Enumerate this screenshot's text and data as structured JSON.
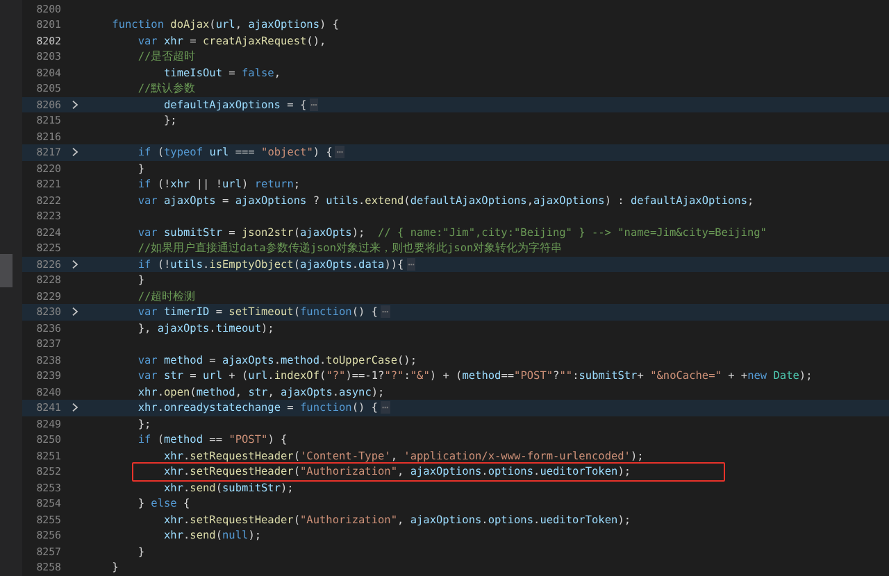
{
  "editor": {
    "lines": [
      {
        "number": "8200",
        "current": false,
        "folded": false,
        "highlighted": false
      },
      {
        "number": "8201",
        "current": false,
        "folded": false,
        "highlighted": false,
        "segs": [
          {
            "kind": "kw",
            "text": "    function "
          },
          {
            "kind": "fn",
            "text": "doAjax"
          },
          {
            "kind": "plain",
            "text": "("
          },
          {
            "kind": "var",
            "text": "url"
          },
          {
            "kind": "plain",
            "text": ", "
          },
          {
            "kind": "var",
            "text": "ajaxOptions"
          },
          {
            "kind": "plain",
            "text": ") {"
          }
        ]
      },
      {
        "number": "8202",
        "current": true,
        "folded": false,
        "highlighted": false,
        "segs": [
          {
            "kind": "kw",
            "text": "        var "
          },
          {
            "kind": "var",
            "text": "xhr"
          },
          {
            "kind": "plain",
            "text": " = "
          },
          {
            "kind": "fn",
            "text": "creatAjaxRequest"
          },
          {
            "kind": "plain",
            "text": "(),"
          }
        ]
      },
      {
        "number": "8203",
        "current": false,
        "folded": false,
        "highlighted": false,
        "segs": [
          {
            "kind": "cm",
            "text": "        //是否超时"
          }
        ]
      },
      {
        "number": "8204",
        "current": false,
        "folded": false,
        "highlighted": false,
        "segs": [
          {
            "kind": "var",
            "text": "            timeIsOut"
          },
          {
            "kind": "plain",
            "text": " = "
          },
          {
            "kind": "kw",
            "text": "false"
          },
          {
            "kind": "plain",
            "text": ","
          }
        ]
      },
      {
        "number": "8205",
        "current": false,
        "folded": false,
        "highlighted": false,
        "segs": [
          {
            "kind": "cm",
            "text": "        //默认参数"
          }
        ]
      },
      {
        "number": "8206",
        "current": false,
        "folded": true,
        "highlighted": false,
        "segs": [
          {
            "kind": "var",
            "text": "            defaultAjaxOptions"
          },
          {
            "kind": "plain",
            "text": " = {"
          },
          {
            "kind": "fold",
            "text": "⋯"
          }
        ]
      },
      {
        "number": "8215",
        "current": false,
        "folded": false,
        "highlighted": false,
        "segs": [
          {
            "kind": "plain",
            "text": "            };"
          }
        ]
      },
      {
        "number": "8216",
        "current": false,
        "folded": false,
        "highlighted": false
      },
      {
        "number": "8217",
        "current": false,
        "folded": true,
        "highlighted": false,
        "segs": [
          {
            "kind": "kw",
            "text": "        if"
          },
          {
            "kind": "plain",
            "text": " ("
          },
          {
            "kind": "kw",
            "text": "typeof "
          },
          {
            "kind": "var",
            "text": "url"
          },
          {
            "kind": "plain",
            "text": " === "
          },
          {
            "kind": "str",
            "text": "\"object\""
          },
          {
            "kind": "plain",
            "text": ") {"
          },
          {
            "kind": "fold",
            "text": "⋯"
          }
        ]
      },
      {
        "number": "8220",
        "current": false,
        "folded": false,
        "highlighted": false,
        "segs": [
          {
            "kind": "plain",
            "text": "        }"
          }
        ]
      },
      {
        "number": "8221",
        "current": false,
        "folded": false,
        "highlighted": false,
        "segs": [
          {
            "kind": "kw",
            "text": "        if"
          },
          {
            "kind": "plain",
            "text": " (!"
          },
          {
            "kind": "var",
            "text": "xhr"
          },
          {
            "kind": "plain",
            "text": " || !"
          },
          {
            "kind": "var",
            "text": "url"
          },
          {
            "kind": "plain",
            "text": ") "
          },
          {
            "kind": "kw",
            "text": "return"
          },
          {
            "kind": "plain",
            "text": ";"
          }
        ]
      },
      {
        "number": "8222",
        "current": false,
        "folded": false,
        "highlighted": false,
        "segs": [
          {
            "kind": "kw",
            "text": "        var "
          },
          {
            "kind": "var",
            "text": "ajaxOpts"
          },
          {
            "kind": "plain",
            "text": " = "
          },
          {
            "kind": "var",
            "text": "ajaxOptions"
          },
          {
            "kind": "plain",
            "text": " ? "
          },
          {
            "kind": "var",
            "text": "utils"
          },
          {
            "kind": "plain",
            "text": "."
          },
          {
            "kind": "fn",
            "text": "extend"
          },
          {
            "kind": "plain",
            "text": "("
          },
          {
            "kind": "var",
            "text": "defaultAjaxOptions"
          },
          {
            "kind": "plain",
            "text": ","
          },
          {
            "kind": "var",
            "text": "ajaxOptions"
          },
          {
            "kind": "plain",
            "text": ") : "
          },
          {
            "kind": "var",
            "text": "defaultAjaxOptions"
          },
          {
            "kind": "plain",
            "text": ";"
          }
        ]
      },
      {
        "number": "8223",
        "current": false,
        "folded": false,
        "highlighted": false
      },
      {
        "number": "8224",
        "current": false,
        "folded": false,
        "highlighted": false,
        "segs": [
          {
            "kind": "kw",
            "text": "        var "
          },
          {
            "kind": "var",
            "text": "submitStr"
          },
          {
            "kind": "plain",
            "text": " = "
          },
          {
            "kind": "fn",
            "text": "json2str"
          },
          {
            "kind": "plain",
            "text": "("
          },
          {
            "kind": "var",
            "text": "ajaxOpts"
          },
          {
            "kind": "plain",
            "text": ");  "
          },
          {
            "kind": "cm",
            "text": "// { name:\"Jim\",city:\"Beijing\" } --> \"name=Jim&city=Beijing\""
          }
        ]
      },
      {
        "number": "8225",
        "current": false,
        "folded": false,
        "highlighted": false,
        "segs": [
          {
            "kind": "cm",
            "text": "        //如果用户直接通过data参数传递json对象过来，则也要将此json对象转化为字符串"
          }
        ]
      },
      {
        "number": "8226",
        "current": false,
        "folded": true,
        "highlighted": false,
        "segs": [
          {
            "kind": "kw",
            "text": "        if"
          },
          {
            "kind": "plain",
            "text": " (!"
          },
          {
            "kind": "var",
            "text": "utils"
          },
          {
            "kind": "plain",
            "text": "."
          },
          {
            "kind": "fn",
            "text": "isEmptyObject"
          },
          {
            "kind": "plain",
            "text": "("
          },
          {
            "kind": "var",
            "text": "ajaxOpts"
          },
          {
            "kind": "plain",
            "text": "."
          },
          {
            "kind": "var",
            "text": "data"
          },
          {
            "kind": "plain",
            "text": ")){"
          },
          {
            "kind": "fold",
            "text": "⋯"
          }
        ]
      },
      {
        "number": "8228",
        "current": false,
        "folded": false,
        "highlighted": false,
        "segs": [
          {
            "kind": "plain",
            "text": "        }"
          }
        ]
      },
      {
        "number": "8229",
        "current": false,
        "folded": false,
        "highlighted": false,
        "segs": [
          {
            "kind": "cm",
            "text": "        //超时检测"
          }
        ]
      },
      {
        "number": "8230",
        "current": false,
        "folded": true,
        "highlighted": false,
        "segs": [
          {
            "kind": "kw",
            "text": "        var "
          },
          {
            "kind": "var",
            "text": "timerID"
          },
          {
            "kind": "plain",
            "text": " = "
          },
          {
            "kind": "fn",
            "text": "setTimeout"
          },
          {
            "kind": "plain",
            "text": "("
          },
          {
            "kind": "kw",
            "text": "function"
          },
          {
            "kind": "plain",
            "text": "() {"
          },
          {
            "kind": "fold",
            "text": "⋯"
          }
        ]
      },
      {
        "number": "8236",
        "current": false,
        "folded": false,
        "highlighted": false,
        "segs": [
          {
            "kind": "plain",
            "text": "        }, "
          },
          {
            "kind": "var",
            "text": "ajaxOpts"
          },
          {
            "kind": "plain",
            "text": "."
          },
          {
            "kind": "var",
            "text": "timeout"
          },
          {
            "kind": "plain",
            "text": ");"
          }
        ]
      },
      {
        "number": "8237",
        "current": false,
        "folded": false,
        "highlighted": false
      },
      {
        "number": "8238",
        "current": false,
        "folded": false,
        "highlighted": false,
        "segs": [
          {
            "kind": "kw",
            "text": "        var "
          },
          {
            "kind": "var",
            "text": "method"
          },
          {
            "kind": "plain",
            "text": " = "
          },
          {
            "kind": "var",
            "text": "ajaxOpts"
          },
          {
            "kind": "plain",
            "text": "."
          },
          {
            "kind": "var",
            "text": "method"
          },
          {
            "kind": "plain",
            "text": "."
          },
          {
            "kind": "fn",
            "text": "toUpperCase"
          },
          {
            "kind": "plain",
            "text": "();"
          }
        ]
      },
      {
        "number": "8239",
        "current": false,
        "folded": false,
        "highlighted": false,
        "segs": [
          {
            "kind": "kw",
            "text": "        var "
          },
          {
            "kind": "var",
            "text": "str"
          },
          {
            "kind": "plain",
            "text": " = "
          },
          {
            "kind": "var",
            "text": "url"
          },
          {
            "kind": "plain",
            "text": " + ("
          },
          {
            "kind": "var",
            "text": "url"
          },
          {
            "kind": "plain",
            "text": "."
          },
          {
            "kind": "fn",
            "text": "indexOf"
          },
          {
            "kind": "plain",
            "text": "("
          },
          {
            "kind": "str",
            "text": "\"?\""
          },
          {
            "kind": "plain",
            "text": ")==-1?"
          },
          {
            "kind": "str",
            "text": "\"?\""
          },
          {
            "kind": "plain",
            "text": ":"
          },
          {
            "kind": "str",
            "text": "\"&\""
          },
          {
            "kind": "plain",
            "text": ") + ("
          },
          {
            "kind": "var",
            "text": "method"
          },
          {
            "kind": "plain",
            "text": "=="
          },
          {
            "kind": "str",
            "text": "\"POST\""
          },
          {
            "kind": "plain",
            "text": "?"
          },
          {
            "kind": "str",
            "text": "\"\""
          },
          {
            "kind": "plain",
            "text": ":"
          },
          {
            "kind": "var",
            "text": "submitStr"
          },
          {
            "kind": "plain",
            "text": "+ "
          },
          {
            "kind": "str",
            "text": "\"&noCache=\""
          },
          {
            "kind": "plain",
            "text": " + +"
          },
          {
            "kind": "kw",
            "text": "new "
          },
          {
            "kind": "cls",
            "text": "Date"
          },
          {
            "kind": "plain",
            "text": ");"
          }
        ]
      },
      {
        "number": "8240",
        "current": false,
        "folded": false,
        "highlighted": false,
        "segs": [
          {
            "kind": "var",
            "text": "        xhr"
          },
          {
            "kind": "plain",
            "text": "."
          },
          {
            "kind": "fn",
            "text": "open"
          },
          {
            "kind": "plain",
            "text": "("
          },
          {
            "kind": "var",
            "text": "method"
          },
          {
            "kind": "plain",
            "text": ", "
          },
          {
            "kind": "var",
            "text": "str"
          },
          {
            "kind": "plain",
            "text": ", "
          },
          {
            "kind": "var",
            "text": "ajaxOpts"
          },
          {
            "kind": "plain",
            "text": "."
          },
          {
            "kind": "var",
            "text": "async"
          },
          {
            "kind": "plain",
            "text": ");"
          }
        ]
      },
      {
        "number": "8241",
        "current": false,
        "folded": true,
        "highlighted": false,
        "segs": [
          {
            "kind": "var",
            "text": "        xhr"
          },
          {
            "kind": "plain",
            "text": "."
          },
          {
            "kind": "var",
            "text": "onreadystatechange"
          },
          {
            "kind": "plain",
            "text": " = "
          },
          {
            "kind": "kw",
            "text": "function"
          },
          {
            "kind": "plain",
            "text": "() {"
          },
          {
            "kind": "fold",
            "text": "⋯"
          }
        ]
      },
      {
        "number": "8249",
        "current": false,
        "folded": false,
        "highlighted": false,
        "segs": [
          {
            "kind": "plain",
            "text": "        };"
          }
        ]
      },
      {
        "number": "8250",
        "current": false,
        "folded": false,
        "highlighted": false,
        "segs": [
          {
            "kind": "kw",
            "text": "        if"
          },
          {
            "kind": "plain",
            "text": " ("
          },
          {
            "kind": "var",
            "text": "method"
          },
          {
            "kind": "plain",
            "text": " == "
          },
          {
            "kind": "str",
            "text": "\"POST\""
          },
          {
            "kind": "plain",
            "text": ") {"
          }
        ]
      },
      {
        "number": "8251",
        "current": false,
        "folded": false,
        "highlighted": false,
        "segs": [
          {
            "kind": "var",
            "text": "            xhr"
          },
          {
            "kind": "plain",
            "text": "."
          },
          {
            "kind": "fn",
            "text": "setRequestHeader"
          },
          {
            "kind": "plain",
            "text": "("
          },
          {
            "kind": "str",
            "text": "'Content-Type'"
          },
          {
            "kind": "plain",
            "text": ", "
          },
          {
            "kind": "str",
            "text": "'application/x-www-form-urlencoded'"
          },
          {
            "kind": "plain",
            "text": ");"
          }
        ]
      },
      {
        "number": "8252",
        "current": false,
        "folded": false,
        "highlighted": true,
        "segs": [
          {
            "kind": "var",
            "text": "            xhr"
          },
          {
            "kind": "plain",
            "text": "."
          },
          {
            "kind": "fn",
            "text": "setRequestHeader"
          },
          {
            "kind": "plain",
            "text": "("
          },
          {
            "kind": "str",
            "text": "\"Authorization\""
          },
          {
            "kind": "plain",
            "text": ", "
          },
          {
            "kind": "var",
            "text": "ajaxOptions"
          },
          {
            "kind": "plain",
            "text": "."
          },
          {
            "kind": "var",
            "text": "options"
          },
          {
            "kind": "plain",
            "text": "."
          },
          {
            "kind": "var",
            "text": "ueditorToken"
          },
          {
            "kind": "plain",
            "text": ");"
          }
        ]
      },
      {
        "number": "8253",
        "current": false,
        "folded": false,
        "highlighted": false,
        "segs": [
          {
            "kind": "var",
            "text": "            xhr"
          },
          {
            "kind": "plain",
            "text": "."
          },
          {
            "kind": "fn",
            "text": "send"
          },
          {
            "kind": "plain",
            "text": "("
          },
          {
            "kind": "var",
            "text": "submitStr"
          },
          {
            "kind": "plain",
            "text": ");"
          }
        ]
      },
      {
        "number": "8254",
        "current": false,
        "folded": false,
        "highlighted": false,
        "segs": [
          {
            "kind": "plain",
            "text": "        } "
          },
          {
            "kind": "kw",
            "text": "else"
          },
          {
            "kind": "plain",
            "text": " {"
          }
        ]
      },
      {
        "number": "8255",
        "current": false,
        "folded": false,
        "highlighted": false,
        "segs": [
          {
            "kind": "var",
            "text": "            xhr"
          },
          {
            "kind": "plain",
            "text": "."
          },
          {
            "kind": "fn",
            "text": "setRequestHeader"
          },
          {
            "kind": "plain",
            "text": "("
          },
          {
            "kind": "str",
            "text": "\"Authorization\""
          },
          {
            "kind": "plain",
            "text": ", "
          },
          {
            "kind": "var",
            "text": "ajaxOptions"
          },
          {
            "kind": "plain",
            "text": "."
          },
          {
            "kind": "var",
            "text": "options"
          },
          {
            "kind": "plain",
            "text": "."
          },
          {
            "kind": "var",
            "text": "ueditorToken"
          },
          {
            "kind": "plain",
            "text": ");"
          }
        ]
      },
      {
        "number": "8256",
        "current": false,
        "folded": false,
        "highlighted": false,
        "segs": [
          {
            "kind": "var",
            "text": "            xhr"
          },
          {
            "kind": "plain",
            "text": "."
          },
          {
            "kind": "fn",
            "text": "send"
          },
          {
            "kind": "plain",
            "text": "("
          },
          {
            "kind": "kw",
            "text": "null"
          },
          {
            "kind": "plain",
            "text": ");"
          }
        ]
      },
      {
        "number": "8257",
        "current": false,
        "folded": false,
        "highlighted": false,
        "segs": [
          {
            "kind": "plain",
            "text": "        }"
          }
        ]
      },
      {
        "number": "8258",
        "current": false,
        "folded": false,
        "highlighted": false,
        "segs": [
          {
            "kind": "plain",
            "text": "    }"
          }
        ]
      }
    ]
  }
}
